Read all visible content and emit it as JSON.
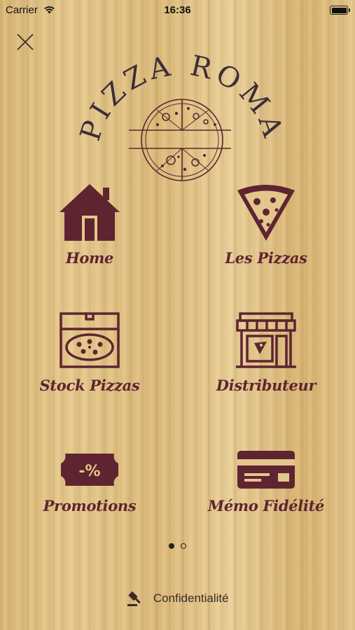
{
  "status_bar": {
    "carrier": "Carrier",
    "time": "16:36"
  },
  "brand": {
    "name": "PIZZA ROMA",
    "color": "#5e2430"
  },
  "menu": [
    {
      "id": "home",
      "label": "Home",
      "icon": "house-icon"
    },
    {
      "id": "pizzas",
      "label": "Les Pizzas",
      "icon": "pizza-slice-icon"
    },
    {
      "id": "stock",
      "label": "Stock Pizzas",
      "icon": "pizza-box-icon"
    },
    {
      "id": "distributor",
      "label": "Distributeur",
      "icon": "storefront-icon"
    },
    {
      "id": "promotions",
      "label": "Promotions",
      "icon": "discount-ticket-icon"
    },
    {
      "id": "loyalty",
      "label": "Mémo Fidélité",
      "icon": "loyalty-card-icon"
    }
  ],
  "pagination": {
    "current": 1,
    "total": 2
  },
  "footer": {
    "privacy_label": "Confidentialité",
    "privacy_icon": "gavel-icon"
  }
}
